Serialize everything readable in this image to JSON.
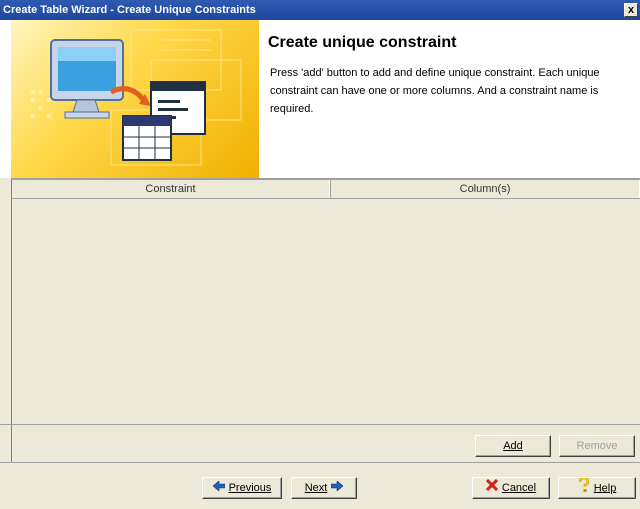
{
  "window": {
    "title": "Create Table Wizard - Create Unique Constraints",
    "close_glyph": "x"
  },
  "header": {
    "title": "Create unique constraint",
    "description": "Press 'add' button to add and define unique constraint. Each unique constraint can have one or more columns. And a constraint name is required."
  },
  "table": {
    "columns": [
      "Constraint",
      "Column(s)"
    ],
    "rows": []
  },
  "actions": {
    "add_label": "Add",
    "remove_label": "Remove"
  },
  "footer": {
    "previous_label": "Previous",
    "next_label": "Next",
    "cancel_label": "Cancel",
    "help_label": "Help"
  },
  "colors": {
    "titlebar": "#2f5bb0",
    "dialog_bg": "#ece9d8",
    "banner": "#ffd84a",
    "cancel_icon": "#d02020",
    "help_icon": "#e8c000",
    "arrow_icon": "#2060c0"
  }
}
